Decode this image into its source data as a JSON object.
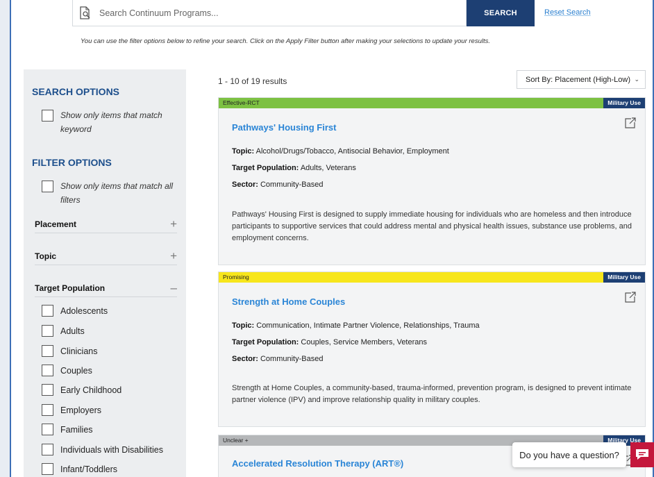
{
  "search": {
    "placeholder": "Search Continuum Programs...",
    "button_label": "SEARCH",
    "reset_label": "Reset Search"
  },
  "filter_hint": "You can use the filter options below to refine your search. Click on the Apply Filter button after making your selections to update your results.",
  "sidebar": {
    "search_options_heading": "SEARCH OPTIONS",
    "keyword_match_line1": "Show only items that match",
    "keyword_match_line2": "keyword",
    "filter_options_heading": "FILTER OPTIONS",
    "all_filters_line1": "Show only items that match all",
    "all_filters_line2": "filters",
    "placement": {
      "label": "Placement",
      "toggle": "+"
    },
    "topic": {
      "label": "Topic",
      "toggle": "+"
    },
    "target_population": {
      "label": "Target Population",
      "toggle": "–",
      "items": [
        "Adolescents",
        "Adults",
        "Clinicians",
        "Couples",
        "Early Childhood",
        "Employers",
        "Families",
        "Individuals with Disabilities",
        "Infant/Toddlers"
      ]
    }
  },
  "results": {
    "count_text": "1 - 10 of 19 results",
    "sort_label": "Sort By: Placement (High-Low)",
    "cards": [
      {
        "rating": "Effective-RCT",
        "rating_color": "#7dc142",
        "military_tag": "Military Use",
        "title": "Pathways' Housing First",
        "topic_label": "Topic:",
        "topic": "Alcohol/Drugs/Tobacco, Antisocial Behavior, Employment",
        "population_label": "Target Population:",
        "population": "Adults, Veterans",
        "sector_label": "Sector:",
        "sector": "Community-Based",
        "description": "Pathways' Housing First is designed to supply immediate housing for individuals who are homeless and then introduce participants to supportive services that could address mental and physical health issues, substance use problems, and employment concerns."
      },
      {
        "rating": "Promising",
        "rating_color": "#f7e61c",
        "military_tag": "Military Use",
        "title": "Strength at Home Couples",
        "topic_label": "Topic:",
        "topic": "Communication, Intimate Partner Violence, Relationships, Trauma",
        "population_label": "Target Population:",
        "population": "Couples, Service Members, Veterans",
        "sector_label": "Sector:",
        "sector": "Community-Based",
        "description": "Strength at Home Couples, a community-based, trauma-informed, prevention program, is designed to prevent intimate partner violence (IPV) and improve relationship quality in military couples."
      },
      {
        "rating": "Unclear +",
        "rating_color": "#b5b7b9",
        "military_tag": "Military Use",
        "title": "Accelerated Resolution Therapy (ART®)"
      }
    ]
  },
  "chat": {
    "prompt": "Do you have a question?"
  }
}
